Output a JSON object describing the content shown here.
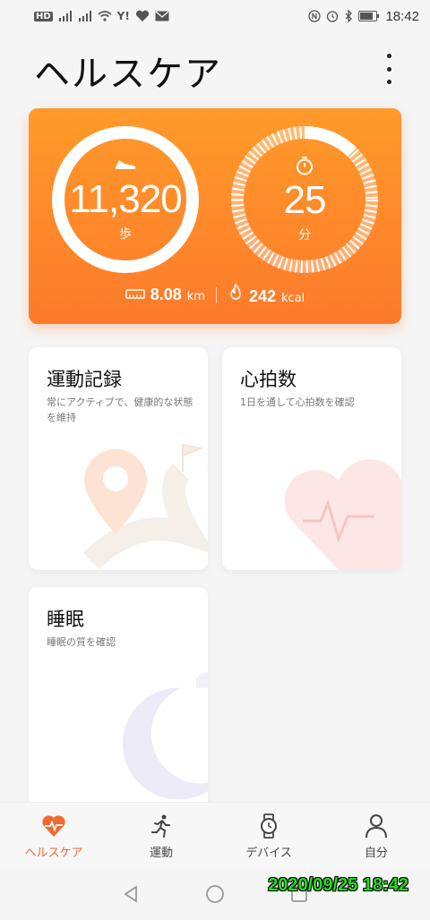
{
  "status_bar": {
    "left_icons": [
      "hd-icon",
      "signal-icon",
      "signal-icon",
      "wifi-icon",
      "yahoo-icon",
      "heart-monitor-icon",
      "mail-icon"
    ],
    "right_icons": [
      "nfc-icon",
      "alarm-icon",
      "bluetooth-icon",
      "battery-icon"
    ],
    "time": "18:42"
  },
  "header": {
    "title": "ヘルスケア",
    "menu_icon": "more-vertical-icon"
  },
  "hero": {
    "gradient": [
      "#ff9a2a",
      "#fd7a2b"
    ],
    "steps_value": "11,320",
    "steps_unit": "歩",
    "steps_progress": 0.95,
    "minutes_value": "25",
    "minutes_unit": "分",
    "distance_value": "8.08",
    "distance_unit": "km",
    "calories_value": "242",
    "calories_unit": "kcal"
  },
  "cards": {
    "exercise": {
      "title": "運動記録",
      "desc": "常にアクティブで、健康的な状態を維持"
    },
    "heart": {
      "title": "心拍数",
      "desc": "1日を通して心拍数を確認"
    },
    "sleep": {
      "title": "睡眠",
      "desc": "睡眠の質を確認"
    }
  },
  "bottom_nav": [
    {
      "label": "ヘルスケア",
      "icon": "heart-pulse-icon",
      "active": true
    },
    {
      "label": "運動",
      "icon": "runner-icon",
      "active": false
    },
    {
      "label": "デバイス",
      "icon": "watch-icon",
      "active": false
    },
    {
      "label": "自分",
      "icon": "person-icon",
      "active": false
    }
  ],
  "accent_color": "#f06a30",
  "watermark": "2020/09/25 18:42"
}
